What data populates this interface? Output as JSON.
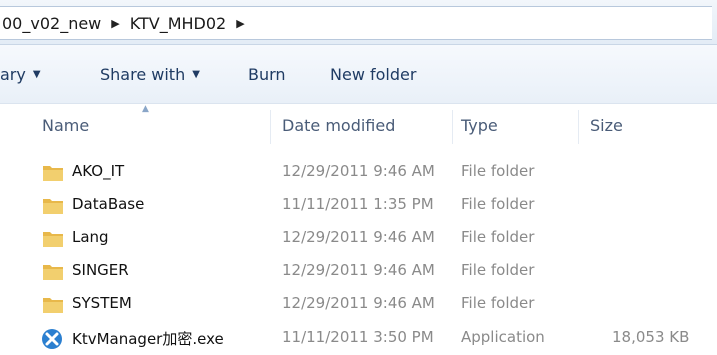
{
  "address": {
    "crumbs": [
      "00_v02_new",
      "KTV_MHD02"
    ]
  },
  "toolbar": {
    "items": [
      {
        "label": "ary",
        "has_dropdown": true
      },
      {
        "label": "Share with",
        "has_dropdown": true
      },
      {
        "label": "Burn",
        "has_dropdown": false
      },
      {
        "label": "New folder",
        "has_dropdown": false
      }
    ]
  },
  "columns": {
    "name": "Name",
    "date": "Date modified",
    "type": "Type",
    "size": "Size"
  },
  "files": [
    {
      "name": "AKO_IT",
      "date": "12/29/2011 9:46 AM",
      "type": "File folder",
      "size": "",
      "icon": "folder-icon"
    },
    {
      "name": "DataBase",
      "date": "11/11/2011 1:35 PM",
      "type": "File folder",
      "size": "",
      "icon": "folder-icon"
    },
    {
      "name": "Lang",
      "date": "12/29/2011 9:46 AM",
      "type": "File folder",
      "size": "",
      "icon": "folder-icon"
    },
    {
      "name": "SINGER",
      "date": "12/29/2011 9:46 AM",
      "type": "File folder",
      "size": "",
      "icon": "folder-icon"
    },
    {
      "name": "SYSTEM",
      "date": "12/29/2011 9:46 AM",
      "type": "File folder",
      "size": "",
      "icon": "folder-icon"
    },
    {
      "name": "KtvManager加密.exe",
      "date": "11/11/2011 3:50 PM",
      "type": "Application",
      "size": "18,053 KB",
      "icon": "application-icon"
    }
  ],
  "colors": {
    "folder": "#e8b84a",
    "app_icon": "#2b7fd0",
    "command_text": "#1f3b63",
    "muted_text": "#8a8a8a"
  }
}
